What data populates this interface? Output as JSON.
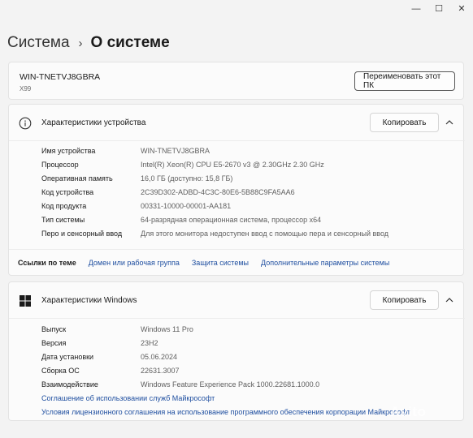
{
  "window": {
    "minimize_glyph": "—",
    "maximize_glyph": "☐",
    "close_glyph": "✕"
  },
  "breadcrumb": {
    "parent": "Система",
    "separator": "›",
    "current": "О системе"
  },
  "pc_card": {
    "device_name": "WIN-TNETVJ8GBRA",
    "model": "X99",
    "rename_button": "Переименовать этот ПК"
  },
  "device_specs": {
    "title": "Характеристики устройства",
    "icon": "info-icon",
    "copy_button": "Копировать",
    "rows": [
      {
        "label": "Имя устройства",
        "value": "WIN-TNETVJ8GBRA"
      },
      {
        "label": "Процессор",
        "value": "Intel(R) Xeon(R) CPU E5-2670 v3 @ 2.30GHz   2.30 GHz"
      },
      {
        "label": "Оперативная память",
        "value": "16,0 ГБ (доступно: 15,8 ГБ)"
      },
      {
        "label": "Код устройства",
        "value": "2C39D302-ADBD-4C3C-80E6-5B88C9FA5AA6"
      },
      {
        "label": "Код продукта",
        "value": "00331-10000-00001-AA181"
      },
      {
        "label": "Тип системы",
        "value": "64-разрядная операционная система, процессор x64"
      },
      {
        "label": "Перо и сенсорный ввод",
        "value": "Для этого монитора недоступен ввод с помощью пера и сенсорный ввод"
      }
    ]
  },
  "related_links": {
    "title": "Ссылки по теме",
    "links": [
      "Домен или рабочая группа",
      "Защита системы",
      "Дополнительные параметры системы"
    ]
  },
  "windows_specs": {
    "title": "Характеристики Windows",
    "icon": "windows-logo-icon",
    "copy_button": "Копировать",
    "rows": [
      {
        "label": "Выпуск",
        "value": "Windows 11 Pro"
      },
      {
        "label": "Версия",
        "value": "23H2"
      },
      {
        "label": "Дата установки",
        "value": "05.06.2024"
      },
      {
        "label": "Сборка ОС",
        "value": "22631.3007"
      },
      {
        "label": "Взаимодействие",
        "value": "Windows Feature Experience Pack 1000.22681.1000.0"
      }
    ],
    "links": [
      "Соглашение об использовании служб Майкрософт",
      "Условия лицензионного соглашения на использование программного обеспечения корпорации Майкрософт"
    ]
  },
  "watermark": "Avito"
}
